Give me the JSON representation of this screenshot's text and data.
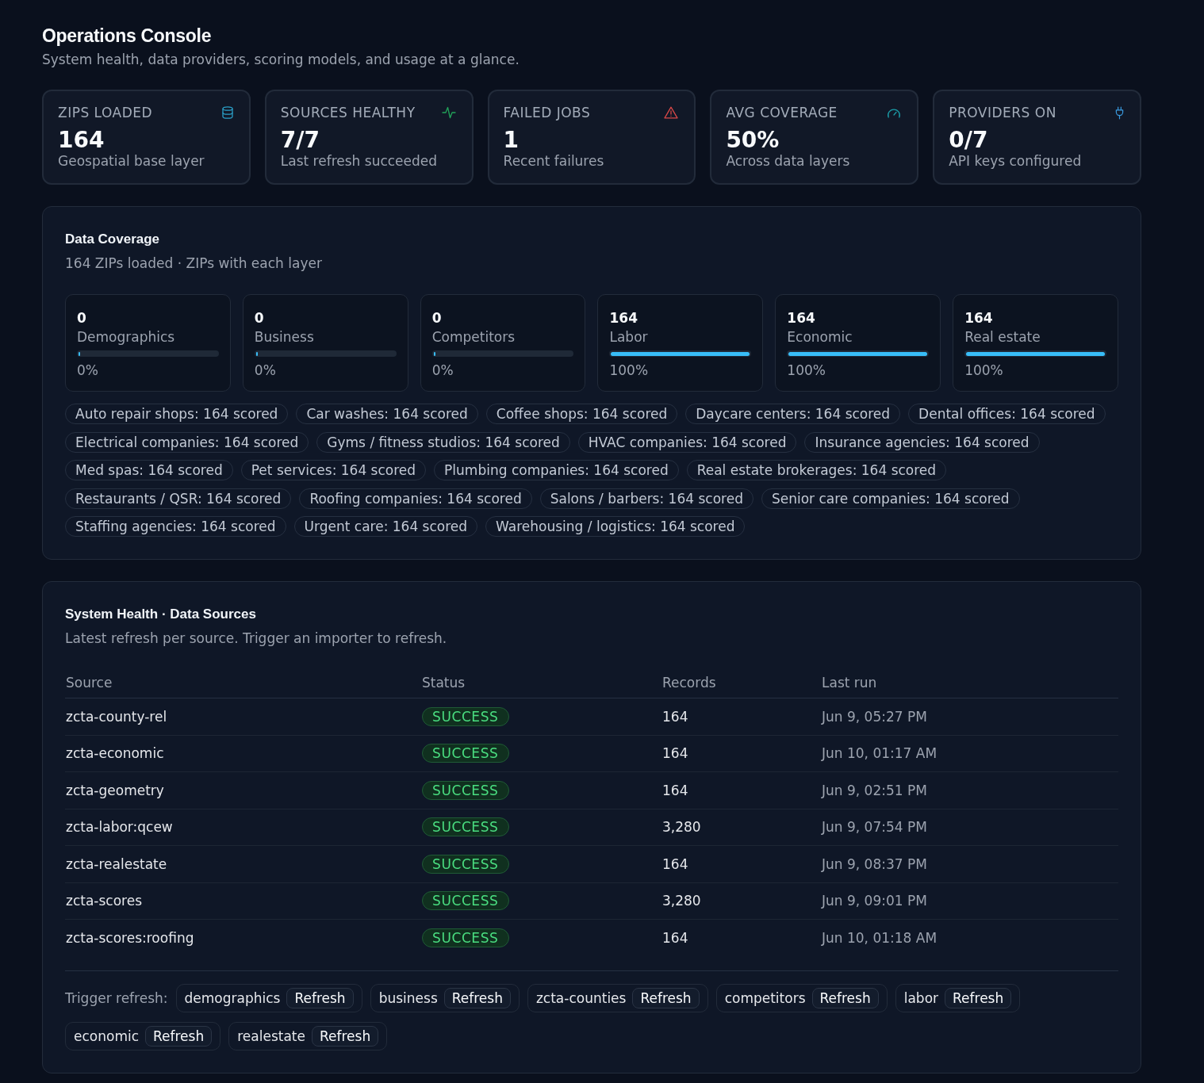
{
  "header": {
    "title": "Operations Console",
    "subtitle": "System health, data providers, scoring models, and usage at a glance."
  },
  "stats": [
    {
      "label": "ZIPS LOADED",
      "kind": "database",
      "value": "164",
      "caption": "Geospatial base layer"
    },
    {
      "label": "SOURCES HEALTHY",
      "kind": "activity",
      "value": "7/7",
      "caption": "Last refresh succeeded"
    },
    {
      "label": "FAILED JOBS",
      "kind": "alert",
      "value": "1",
      "caption": "Recent failures"
    },
    {
      "label": "AVG COVERAGE",
      "kind": "gauge",
      "value": "50%",
      "caption": "Across data layers"
    },
    {
      "label": "PROVIDERS ON",
      "kind": "plug",
      "value": "0/7",
      "caption": "API keys configured"
    }
  ],
  "coverage": {
    "title": "Data Coverage",
    "subtitle": "164 ZIPs loaded · ZIPs with each layer",
    "layers": [
      {
        "count": "0",
        "name": "Demographics",
        "level": 0,
        "percent": "0%"
      },
      {
        "count": "0",
        "name": "Business",
        "level": 0,
        "percent": "0%"
      },
      {
        "count": "0",
        "name": "Competitors",
        "level": 0,
        "percent": "0%"
      },
      {
        "count": "164",
        "name": "Labor",
        "level": 1,
        "percent": "100%"
      },
      {
        "count": "164",
        "name": "Economic",
        "level": 1,
        "percent": "100%"
      },
      {
        "count": "164",
        "name": "Real estate",
        "level": 1,
        "percent": "100%"
      }
    ],
    "scored": [
      "Auto repair shops: 164 scored",
      "Car washes: 164 scored",
      "Coffee shops: 164 scored",
      "Daycare centers: 164 scored",
      "Dental offices: 164 scored",
      "Electrical companies: 164 scored",
      "Gyms / fitness studios: 164 scored",
      "HVAC companies: 164 scored",
      "Insurance agencies: 164 scored",
      "Med spas: 164 scored",
      "Pet services: 164 scored",
      "Plumbing companies: 164 scored",
      "Real estate brokerages: 164 scored",
      "Restaurants / QSR: 164 scored",
      "Roofing companies: 164 scored",
      "Salons / barbers: 164 scored",
      "Senior care companies: 164 scored",
      "Staffing agencies: 164 scored",
      "Urgent care: 164 scored",
      "Warehousing / logistics: 164 scored"
    ]
  },
  "health": {
    "title": "System Health · Data Sources",
    "subtitle": "Latest refresh per source. Trigger an importer to refresh.",
    "table": {
      "columns": [
        "Source",
        "Status",
        "Records",
        "Last run"
      ],
      "rows": [
        {
          "source": "zcta-county-rel",
          "status": "SUCCESS",
          "kind": "success",
          "records": "164",
          "last_run": "Jun 9, 05:27 PM"
        },
        {
          "source": "zcta-economic",
          "status": "SUCCESS",
          "kind": "success",
          "records": "164",
          "last_run": "Jun 10, 01:17 AM"
        },
        {
          "source": "zcta-geometry",
          "status": "SUCCESS",
          "kind": "success",
          "records": "164",
          "last_run": "Jun 9, 02:51 PM"
        },
        {
          "source": "zcta-labor:qcew",
          "status": "SUCCESS",
          "kind": "success",
          "records": "3,280",
          "last_run": "Jun 9, 07:54 PM"
        },
        {
          "source": "zcta-realestate",
          "status": "SUCCESS",
          "kind": "success",
          "records": "164",
          "last_run": "Jun 9, 08:37 PM"
        },
        {
          "source": "zcta-scores",
          "status": "SUCCESS",
          "kind": "success",
          "records": "3,280",
          "last_run": "Jun 9, 09:01 PM"
        },
        {
          "source": "zcta-scores:roofing",
          "status": "SUCCESS",
          "kind": "success",
          "records": "164",
          "last_run": "Jun 10, 01:18 AM"
        }
      ]
    },
    "trigger": {
      "label": "Trigger refresh:",
      "importers": [
        {
          "name": "demographics",
          "button": "Refresh"
        },
        {
          "name": "business",
          "button": "Refresh"
        },
        {
          "name": "zcta-counties",
          "button": "Refresh"
        },
        {
          "name": "competitors",
          "button": "Refresh"
        },
        {
          "name": "labor",
          "button": "Refresh"
        },
        {
          "name": "economic",
          "button": "Refresh"
        },
        {
          "name": "realestate",
          "button": "Refresh"
        }
      ]
    }
  }
}
